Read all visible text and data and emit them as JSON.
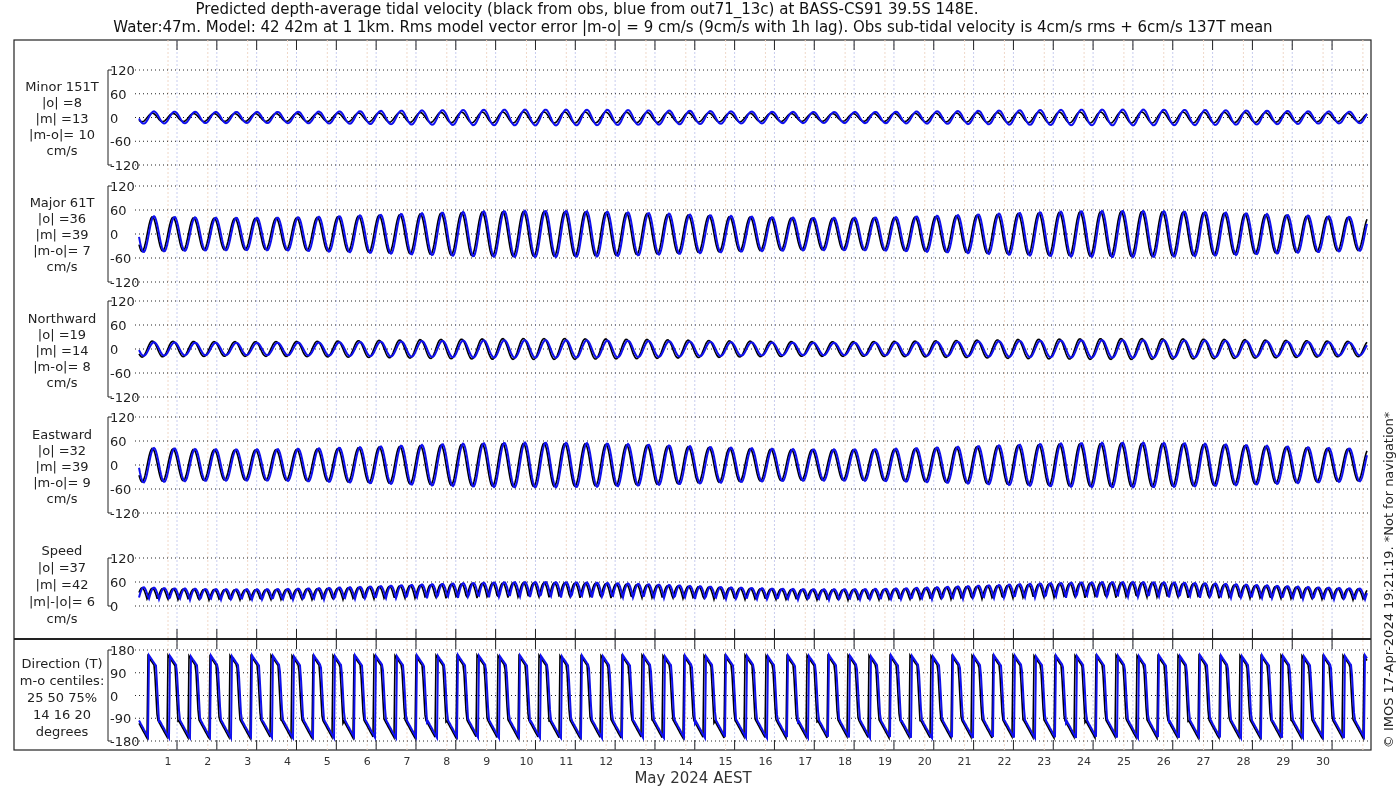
{
  "title": {
    "lines": [
      "Predicted depth-average tidal velocity (black from obs, blue from out71_13c) at BASS-CS91 39.5S 148E.",
      "Water:47m. Model: 42 42m at 1 1km. Rms model vector error |m-o| = 9 cm/s (9cm/s with 1h lag). Obs sub-tidal velocity is 4cm/s rms + 6cm/s 137T mean"
    ]
  },
  "panels": [
    {
      "kind": "signed",
      "label_lines": [
        "Minor 151T",
        "|o| =8",
        "|m| =13",
        "|m-o|= 10",
        "cm/s"
      ],
      "yticks": [
        "120",
        "60",
        "0",
        "-60",
        "-120"
      ]
    },
    {
      "kind": "signed",
      "label_lines": [
        "Major 61T",
        "|o| =36",
        "|m| =39",
        "|m-o|= 7",
        "cm/s"
      ],
      "yticks": [
        "120",
        "60",
        "0",
        "-60",
        "-120"
      ]
    },
    {
      "kind": "signed",
      "label_lines": [
        "Northward",
        "|o| =19",
        "|m| =14",
        "|m-o|= 8",
        "cm/s"
      ],
      "yticks": [
        "120",
        "60",
        "0",
        "-60",
        "-120"
      ]
    },
    {
      "kind": "signed",
      "label_lines": [
        "Eastward",
        "|o| =32",
        "|m| =39",
        "|m-o|= 9",
        "cm/s"
      ],
      "yticks": [
        "120",
        "60",
        "0",
        "-60",
        "-120"
      ]
    },
    {
      "kind": "speed",
      "label_lines": [
        "Speed",
        "|o| =37",
        "|m| =42",
        "|m|-|o|= 6",
        "cm/s"
      ],
      "yticks": [
        "120",
        "60",
        "0"
      ]
    },
    {
      "kind": "direction",
      "label_lines": [
        "Direction (T)",
        "m-o centiles:",
        "25  50  75%",
        "14  16  20",
        "degrees"
      ],
      "yticks": [
        "180",
        "90",
        "0",
        "-90",
        "-180"
      ]
    }
  ],
  "x_axis": {
    "day_labels": [
      "1",
      "2",
      "3",
      "4",
      "5",
      "6",
      "7",
      "8",
      "9",
      "10",
      "11",
      "12",
      "13",
      "14",
      "15",
      "16",
      "17",
      "18",
      "19",
      "20",
      "21",
      "22",
      "23",
      "24",
      "25",
      "26",
      "27",
      "28",
      "29",
      "30"
    ],
    "label": "May 2024 AEST"
  },
  "copyright": "© IMOS 17-Apr-2024 19:21:19. *Not for navigation*"
}
